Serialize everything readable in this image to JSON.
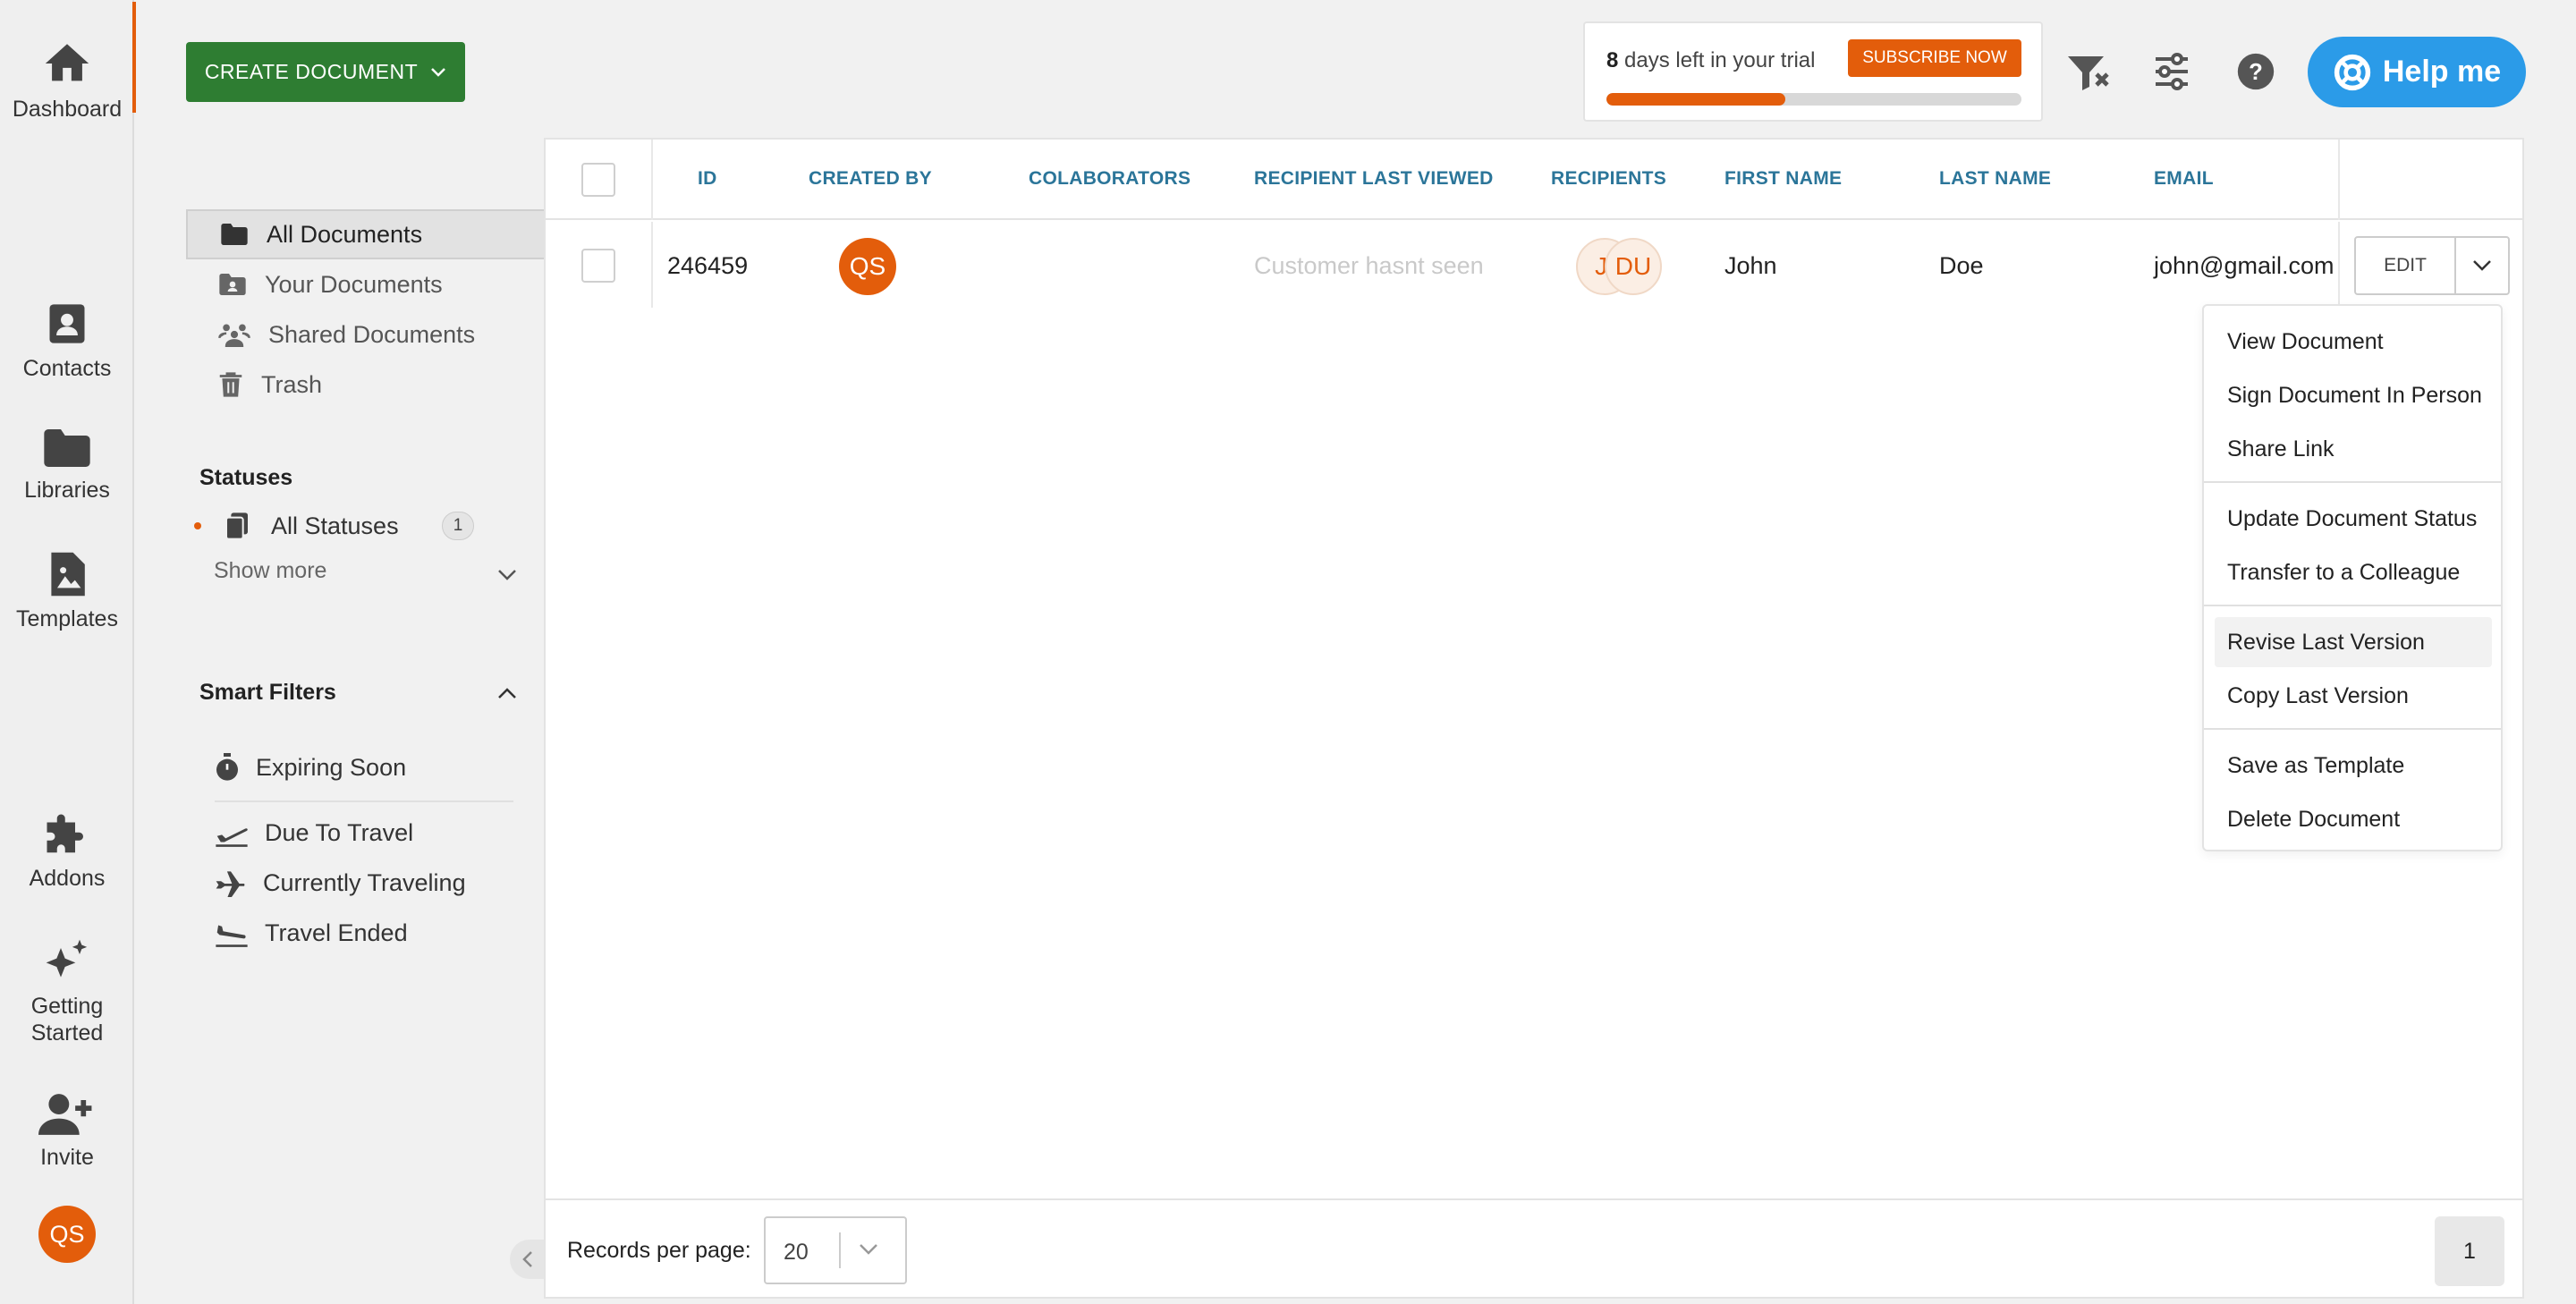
{
  "rail": {
    "items": [
      {
        "label": "Dashboard",
        "icon": "home-icon"
      },
      {
        "label": "Contacts",
        "icon": "contacts-icon"
      },
      {
        "label": "Libraries",
        "icon": "folder-icon"
      },
      {
        "label": "Templates",
        "icon": "template-icon"
      },
      {
        "label": "Addons",
        "icon": "puzzle-icon"
      },
      {
        "label_line1": "Getting",
        "label_line2": "Started",
        "icon": "sparkle-icon"
      },
      {
        "label": "Invite",
        "icon": "add-user-icon"
      }
    ],
    "avatar": "QS"
  },
  "toolbar": {
    "create_label": "CREATE DOCUMENT",
    "trial_days": "8",
    "trial_text": " days left in your trial",
    "subscribe_label": "SUBSCRIBE NOW",
    "trial_progress": 0.43,
    "help_label": "Help me"
  },
  "folders": [
    {
      "label": "All Documents",
      "icon": "folder-icon"
    },
    {
      "label": "Your Documents",
      "icon": "user-folder-icon"
    },
    {
      "label": "Shared Documents",
      "icon": "shared-users-icon"
    },
    {
      "label": "Trash",
      "icon": "trash-icon"
    }
  ],
  "statuses": {
    "title": "Statuses",
    "all_label": "All Statuses",
    "all_count": "1",
    "show_more": "Show more"
  },
  "smart_filters": {
    "title": "Smart Filters",
    "items": [
      {
        "label": "Expiring Soon",
        "icon": "stopwatch-icon"
      },
      {
        "label": "Due To Travel",
        "icon": "plane-departure-icon"
      },
      {
        "label": "Currently Traveling",
        "icon": "plane-icon"
      },
      {
        "label": "Travel Ended",
        "icon": "plane-arrival-icon"
      }
    ]
  },
  "table": {
    "headers": [
      "ID",
      "CREATED BY",
      "COLABORATORS",
      "RECIPIENT LAST VIEWED",
      "RECIPIENTS",
      "FIRST NAME",
      "LAST NAME",
      "EMAIL"
    ],
    "row": {
      "id": "246459",
      "created_by": "QS",
      "recipient_last_viewed": "Customer hasnt seen",
      "recipient_1": "JI",
      "recipient_2": "DU",
      "first_name": "John",
      "last_name": "Doe",
      "email": "john@gmail.com",
      "edit_label": "EDIT"
    }
  },
  "menu": {
    "items": [
      "View Document",
      "Sign Document In Person",
      "Share Link",
      "Update Document Status",
      "Transfer to a Colleague",
      "Revise Last Version",
      "Copy Last Version",
      "Save as Template",
      "Delete Document"
    ]
  },
  "footer": {
    "records_label": "Records per page:",
    "records_value": "20",
    "page": "1"
  },
  "colors": {
    "brand_orange": "#e35d0b",
    "create_green": "#2e7d32",
    "help_blue": "#2b9be8",
    "header_teal": "#2b7599"
  }
}
